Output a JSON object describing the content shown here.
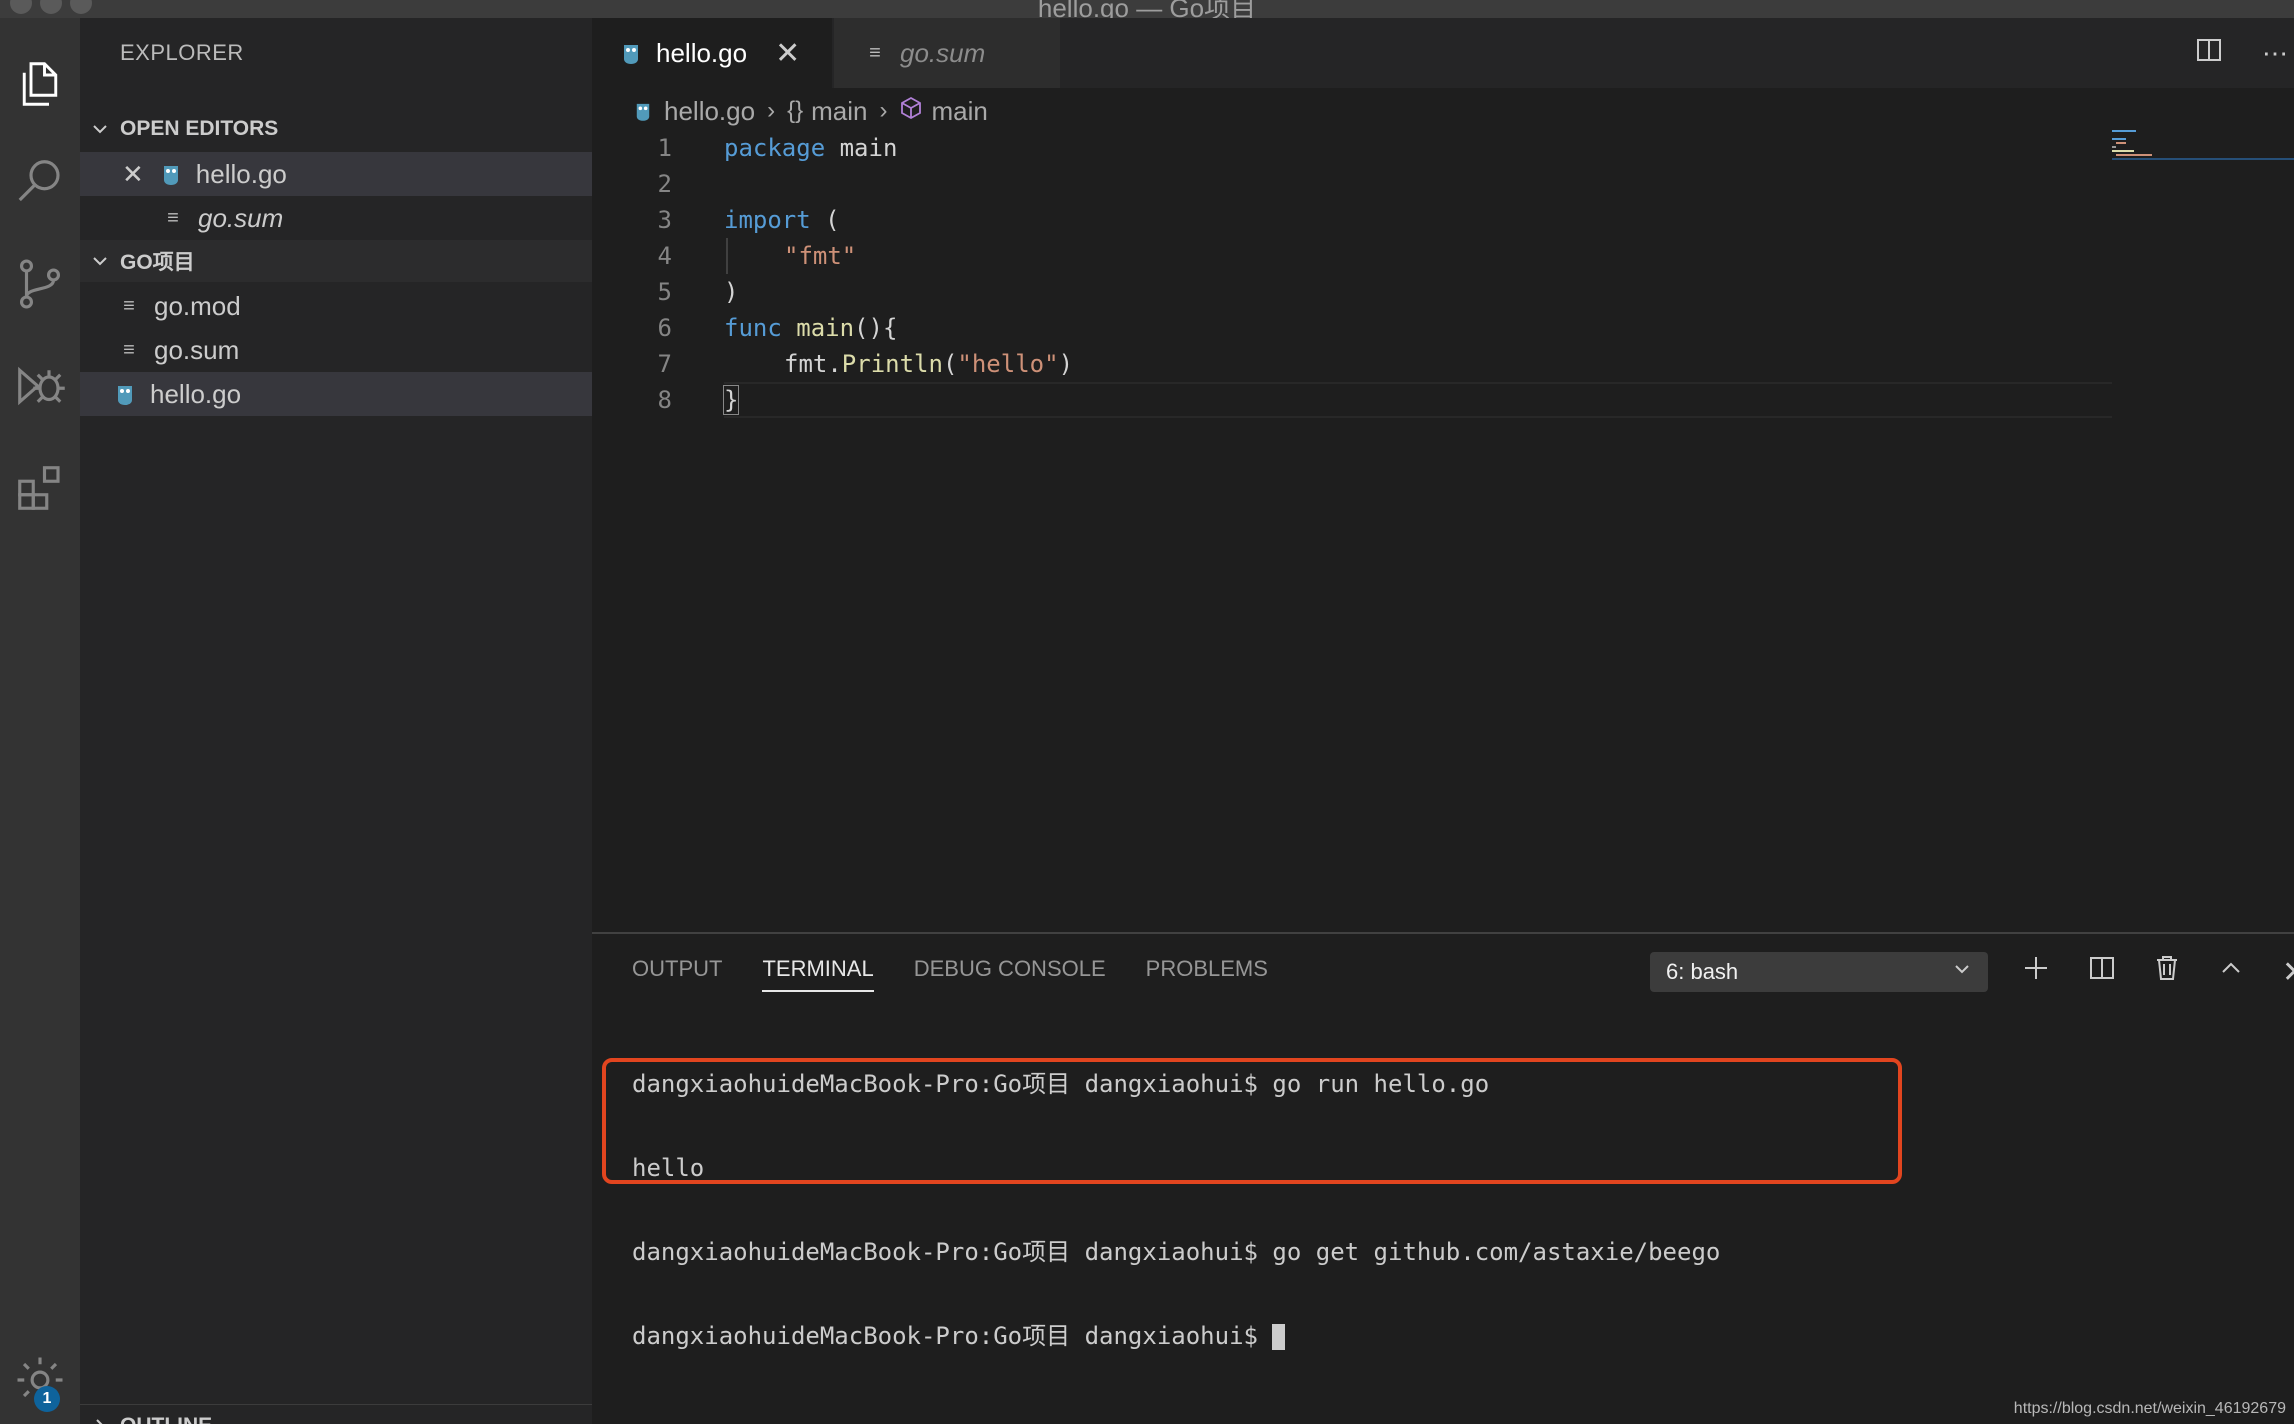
{
  "window": {
    "title": "hello.go — Go项目"
  },
  "sidebar": {
    "title": "EXPLORER",
    "open_editors_header": "OPEN EDITORS",
    "open_editors": [
      {
        "label": "hello.go"
      },
      {
        "label": "go.sum"
      }
    ],
    "project_header": "GO项目",
    "files": [
      {
        "label": "go.mod"
      },
      {
        "label": "go.sum"
      },
      {
        "label": "hello.go"
      }
    ],
    "outline_header": "OUTLINE"
  },
  "activity": {
    "settings_badge": "1"
  },
  "tabs": [
    {
      "label": "hello.go"
    },
    {
      "label": "go.sum"
    }
  ],
  "breadcrumb": {
    "file": "hello.go",
    "scope_braces": "{}",
    "scope": "main",
    "symbol": "main"
  },
  "code": {
    "line_numbers": [
      "1",
      "2",
      "3",
      "4",
      "5",
      "6",
      "7",
      "8"
    ],
    "l1_kw": "package",
    "l1_rest": " main",
    "l3_kw": "import",
    "l3_rest": " (",
    "l4_str": "\"fmt\"",
    "l5": ")",
    "l6_kw": "func",
    "l6_fn": " main",
    "l6_rest": "(){",
    "l7_pkg": "fmt.",
    "l7_fn": "Println",
    "l7_open": "(",
    "l7_str": "\"hello\"",
    "l7_close": ")",
    "l8": "}"
  },
  "panel": {
    "tabs": [
      "OUTPUT",
      "TERMINAL",
      "DEBUG CONSOLE",
      "PROBLEMS"
    ],
    "terminal_select": "6: bash",
    "terminal_lines": [
      "dangxiaohuideMacBook-Pro:Go项目 dangxiaohui$ go run hello.go",
      "hello",
      "dangxiaohuideMacBook-Pro:Go项目 dangxiaohui$ go get github.com/astaxie/beego",
      "dangxiaohuideMacBook-Pro:Go项目 dangxiaohui$ "
    ]
  },
  "watermark": "https://blog.csdn.net/weixin_46192679",
  "colors": {
    "highlight_box": "#e2451f",
    "keyword": "#569cd6",
    "string": "#ce9178",
    "function": "#dcdcaa",
    "go_icon": "#519aba"
  }
}
